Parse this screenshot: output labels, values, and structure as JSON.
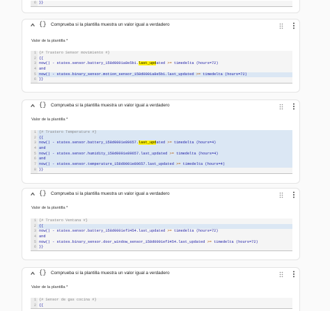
{
  "card_title": "Comprueba si la plantilla muestra un valor igual a verdadero",
  "field_label": "Valor de la plantilla *",
  "icons": {
    "collapse": "chevron-up-icon",
    "type": "braces-icon",
    "drag": "drag-handle-icon",
    "menu": "more-vertical-icon"
  },
  "colors": {
    "highlight": "#dbe7f4",
    "match": "#fff200",
    "code": "#1a1aa6",
    "comment": "#888888"
  },
  "top_card": {
    "lines": [
      {
        "num": "6",
        "hl": false,
        "segs": [
          {
            "t": "}}",
            "c": ""
          }
        ]
      }
    ]
  },
  "cards": [
    {
      "lines": [
        {
          "num": "1",
          "hl": false,
          "segs": [
            {
              "t": "{# Trastero Sensor movimiento #}",
              "c": "cm"
            }
          ]
        },
        {
          "num": "2",
          "hl": false,
          "segs": [
            {
              "t": "{{",
              "c": ""
            }
          ]
        },
        {
          "num": "3",
          "hl": false,
          "segs": [
            {
              "t": "now() - states.sensor.battery_158d0001a8e5b1.",
              "c": ""
            },
            {
              "t": "last_upd",
              "c": "mk"
            },
            {
              "t": "ated ",
              "c": ""
            },
            {
              "t": ">=",
              "c": "op"
            },
            {
              "t": " timedelta (hours=72)",
              "c": ""
            }
          ]
        },
        {
          "num": "4",
          "hl": false,
          "segs": [
            {
              "t": "and",
              "c": ""
            }
          ]
        },
        {
          "num": "5",
          "hl": true,
          "segs": [
            {
              "t": "now() - states.binary_sensor.motion_sensor_158d0001a8e5b1.last_updated ",
              "c": ""
            },
            {
              "t": ">=",
              "c": "op"
            },
            {
              "t": " timedelta (hours=72)",
              "c": ""
            }
          ]
        },
        {
          "num": "6",
          "hl": false,
          "segs": [
            {
              "t": "}}",
              "c": ""
            }
          ]
        }
      ]
    },
    {
      "lines": [
        {
          "num": "1",
          "hl": true,
          "segs": [
            {
              "t": "{# Trastero Temperature #}",
              "c": "cm"
            }
          ]
        },
        {
          "num": "2",
          "hl": true,
          "segs": [
            {
              "t": "{{",
              "c": ""
            }
          ]
        },
        {
          "num": "3",
          "hl": true,
          "segs": [
            {
              "t": "now() - states.sensor.battery_158d0001e89657.",
              "c": ""
            },
            {
              "t": "last_upd",
              "c": "mk"
            },
            {
              "t": "ated ",
              "c": ""
            },
            {
              "t": ">=",
              "c": "op"
            },
            {
              "t": " timedelta (hours=4)",
              "c": ""
            }
          ]
        },
        {
          "num": "4",
          "hl": true,
          "segs": [
            {
              "t": "and",
              "c": ""
            }
          ]
        },
        {
          "num": "5",
          "hl": true,
          "segs": [
            {
              "t": "now() - states.sensor.humidity_158d0001e89657.last_updated ",
              "c": ""
            },
            {
              "t": ">=",
              "c": "op"
            },
            {
              "t": " timedelta (hours=4)",
              "c": ""
            }
          ]
        },
        {
          "num": "6",
          "hl": true,
          "segs": [
            {
              "t": "and",
              "c": ""
            }
          ]
        },
        {
          "num": "7",
          "hl": true,
          "segs": [
            {
              "t": "now() - states.sensor.temperature_158d0001e89657.last_updated ",
              "c": ""
            },
            {
              "t": ">=",
              "c": "op"
            },
            {
              "t": " timedelta (hours=4)",
              "c": ""
            }
          ]
        },
        {
          "num": "8",
          "hl": false,
          "segs": [
            {
              "t": "}}",
              "c": ""
            }
          ]
        }
      ]
    },
    {
      "lines": [
        {
          "num": "1",
          "hl": false,
          "segs": [
            {
              "t": "{# Trastero Ventana #}",
              "c": "cm"
            }
          ]
        },
        {
          "num": "2",
          "hl": true,
          "segs": [
            {
              "t": "{{",
              "c": ""
            }
          ]
        },
        {
          "num": "3",
          "hl": false,
          "segs": [
            {
              "t": "now() - states.sensor.battery_158d0001ef3454.last_updated ",
              "c": ""
            },
            {
              "t": ">=",
              "c": "op"
            },
            {
              "t": " timedelta (hours=72)",
              "c": ""
            }
          ]
        },
        {
          "num": "4",
          "hl": false,
          "segs": [
            {
              "t": "and",
              "c": ""
            }
          ]
        },
        {
          "num": "5",
          "hl": false,
          "segs": [
            {
              "t": "now() - states.binary_sensor.door_window_sensor_158d0001ef3454.last_updated ",
              "c": ""
            },
            {
              "t": ">=",
              "c": "op"
            },
            {
              "t": " timedelta (hours=72)",
              "c": ""
            }
          ]
        },
        {
          "num": "6",
          "hl": false,
          "segs": [
            {
              "t": "}}",
              "c": ""
            }
          ]
        }
      ]
    },
    {
      "lines": [
        {
          "num": "1",
          "hl": false,
          "segs": [
            {
              "t": "{# Sensor de gas cocina #}",
              "c": "cm"
            }
          ]
        },
        {
          "num": "2",
          "hl": false,
          "segs": [
            {
              "t": "{{",
              "c": ""
            }
          ]
        }
      ]
    }
  ]
}
